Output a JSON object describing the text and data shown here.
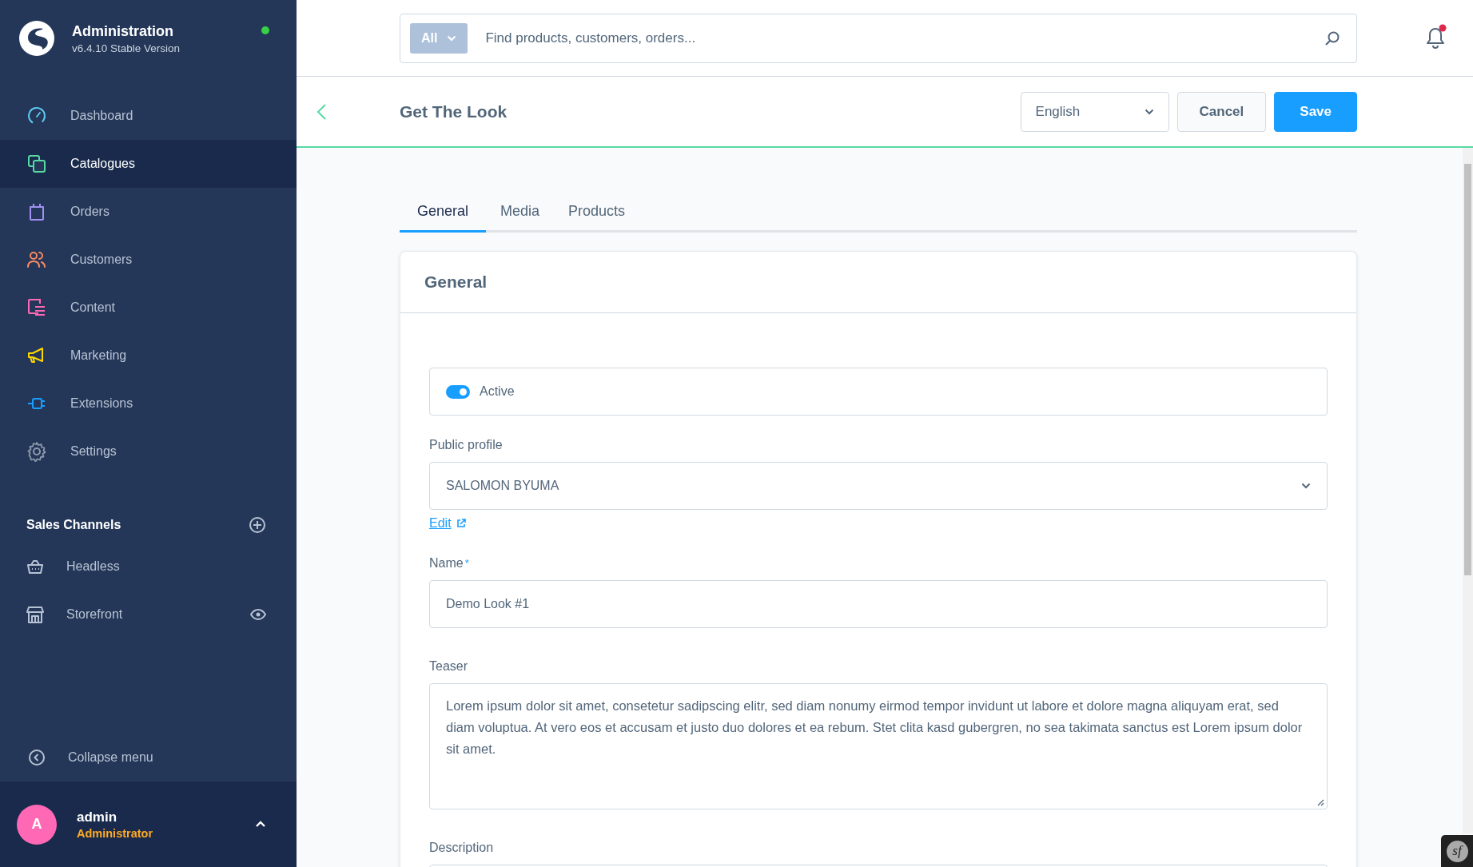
{
  "sidebar": {
    "app_title": "Administration",
    "version": "v6.4.10 Stable Version",
    "online": true,
    "nav": [
      {
        "label": "Dashboard",
        "color": "#5fc9ef",
        "selected": false
      },
      {
        "label": "Catalogues",
        "color": "#57d9a3",
        "selected": true
      },
      {
        "label": "Orders",
        "color": "#a092f0",
        "selected": false
      },
      {
        "label": "Customers",
        "color": "#f88962",
        "selected": false
      },
      {
        "label": "Content",
        "color": "#ff68b4",
        "selected": false
      },
      {
        "label": "Marketing",
        "color": "#ffd700",
        "selected": false
      },
      {
        "label": "Extensions",
        "color": "#189eff",
        "selected": false
      },
      {
        "label": "Settings",
        "color": "#8e9aae",
        "selected": false
      }
    ],
    "sales_channels": {
      "title": "Sales Channels",
      "items": [
        {
          "label": "Headless",
          "has_preview": false
        },
        {
          "label": "Storefront",
          "has_preview": true
        }
      ]
    },
    "collapse": "Collapse menu",
    "user": {
      "initial": "A",
      "name": "admin",
      "role": "Administrator"
    }
  },
  "search": {
    "scope": "All",
    "placeholder": "Find products, customers, orders..."
  },
  "notifications": {
    "unread": true
  },
  "page_header": {
    "title": "Get The Look",
    "language": "English",
    "buttons": [
      {
        "label": "Cancel",
        "kind": "secondary"
      },
      {
        "label": "Save",
        "kind": "primary"
      }
    ]
  },
  "tabs": [
    {
      "label": "General",
      "selected": true
    },
    {
      "label": "Media",
      "selected": false
    },
    {
      "label": "Products",
      "selected": false
    }
  ],
  "card": {
    "title": "General",
    "fields": [
      {
        "kind": "toggle",
        "label": "Active",
        "on": true
      },
      {
        "kind": "select",
        "label": "Public profile",
        "value": "SALOMON BYUMA",
        "link": "Edit"
      },
      {
        "kind": "text",
        "label": "Name",
        "required_mark": "*",
        "value": "Demo Look #1"
      },
      {
        "kind": "textarea",
        "label": "Teaser",
        "value": "Lorem ipsum dolor sit amet, consetetur sadipscing elitr, sed diam nonumy eirmod tempor invidunt ut labore et dolore magna aliquyam erat, sed diam voluptua. At vero eos et accusam et justo duo dolores et ea rebum. Stet clita kasd gubergren, no sea takimata sanctus est Lorem ipsum dolor sit amet."
      },
      {
        "kind": "textarea",
        "label": "Description"
      }
    ]
  },
  "debug_toolbar": {
    "label": "sf"
  }
}
